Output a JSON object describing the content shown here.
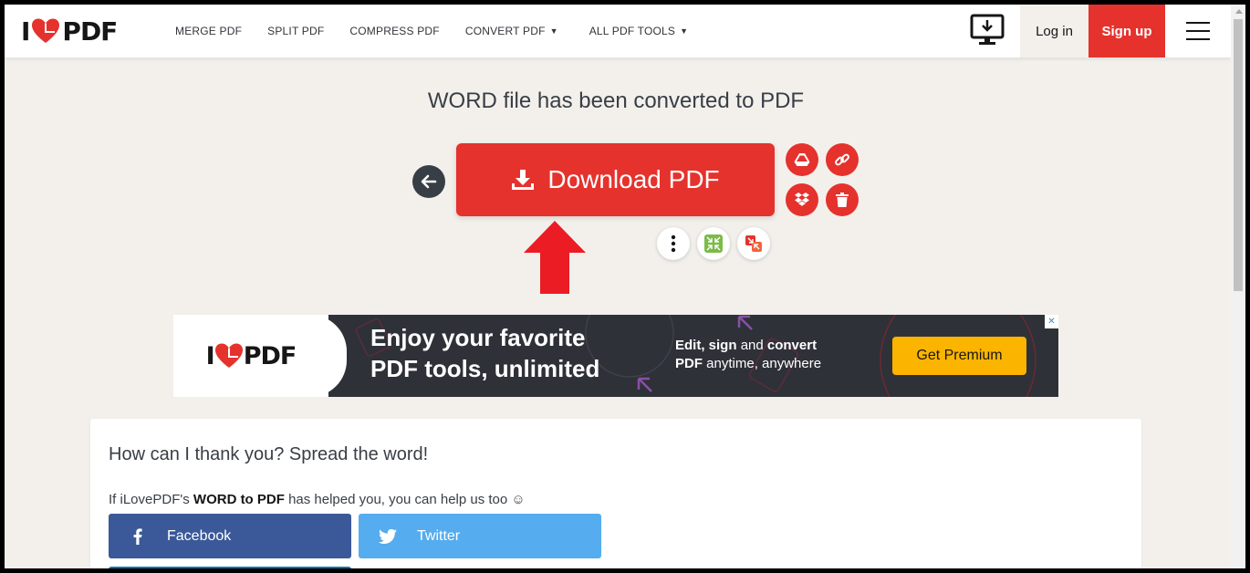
{
  "header": {
    "logo_i": "I",
    "logo_pdf": "PDF",
    "nav": [
      {
        "label": "MERGE PDF"
      },
      {
        "label": "SPLIT PDF"
      },
      {
        "label": "COMPRESS PDF"
      },
      {
        "label": "CONVERT PDF"
      },
      {
        "label": "ALL PDF TOOLS"
      }
    ],
    "caret": "▼",
    "login": "Log in",
    "signup": "Sign up"
  },
  "main": {
    "title": "WORD file has been converted to PDF",
    "download_label": "Download PDF"
  },
  "ad": {
    "logo_i": "I",
    "logo_pdf": "PDF",
    "headline_1": "Enjoy your favorite",
    "headline_2": "PDF tools, unlimited",
    "sub_edit": "Edit,",
    "sub_sign": "sign",
    "sub_and": "and",
    "sub_convert": "convert",
    "sub_pdf": "PDF",
    "sub_rest": "anytime, anywhere",
    "cta": "Get Premium",
    "close": "✕"
  },
  "share": {
    "title": "How can I thank you? Spread the word!",
    "text_prefix": "If iLovePDF's",
    "text_bold": "WORD to PDF",
    "text_suffix": "has helped you, you can help us too ☺",
    "facebook": "Facebook",
    "twitter": "Twitter"
  },
  "colors": {
    "brand_red": "#e5322d",
    "dark": "#383e45",
    "premium": "#fbb400",
    "facebook": "#3b5998",
    "twitter": "#55acee"
  }
}
